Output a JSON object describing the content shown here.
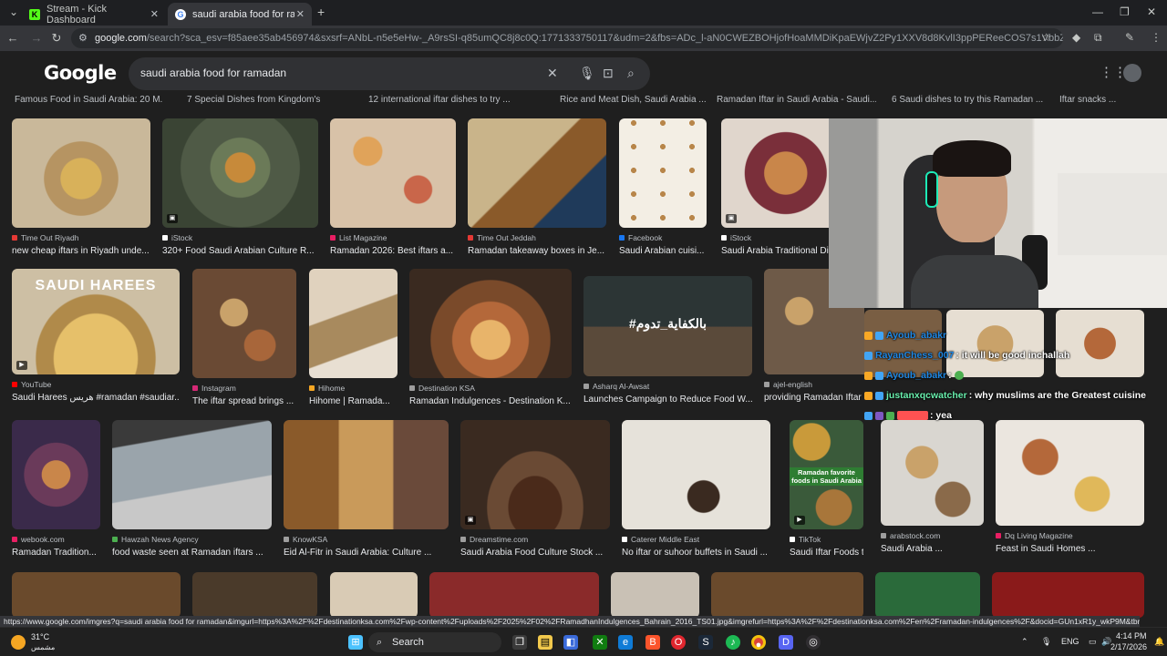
{
  "tabs": [
    {
      "title": "Stream - Kick Dashboard",
      "favicon": "K",
      "color": "#53fc18"
    },
    {
      "title": "saudi arabia food for ramadan",
      "favicon": "G",
      "color": "#ffffff"
    }
  ],
  "window": {
    "minimize": "—",
    "maximize": "❐",
    "close": "✕",
    "new_tab": "+"
  },
  "address": {
    "host": "google.com",
    "path": "/search?sca_esv=f85aee35ab456974&sxsrf=ANbL-n5e5eHw-_A9rsSI-q85umQC8j8c0Q:1771333750117&udm=2&fbs=ADc_l-aN0CWEZBOHjofHoaMMDiKpaEWjvZ2Py1XXV8d8KvlI3ppPEReeCOS7s1VbbZz2TLsHwpSX8VU1h5wlQRdyYz8mD..."
  },
  "google": {
    "logo": "Google",
    "query": "saudi arabia food for ramadan"
  },
  "top_row_captions": [
    "Famous Food in Saudi Arabia: 20 M...",
    "7 Special Dishes from Kingdom's ...",
    "12 international iftar dishes to try ...",
    "Rice and Meat Dish, Saudi Arabia ...",
    "Ramadan Iftar in Saudi Arabia - Saudi...",
    "6 Saudi dishes to try this Ramadan ...",
    "Iftar snacks ..."
  ],
  "rows": [
    [
      {
        "source": "Time Out Riyadh",
        "caption": "new cheap iftars in Riyadh unde...",
        "color": "#b69462",
        "src_color": "#e53935"
      },
      {
        "source": "iStock",
        "caption": "320+ Food Saudi Arabian Culture R...",
        "color": "#5c6b52",
        "src_color": "#ffffff"
      },
      {
        "source": "List Magazine",
        "caption": "Ramadan 2026: Best iftars a...",
        "color": "#c9a98a",
        "src_color": "#e91e63"
      },
      {
        "source": "Time Out Jeddah",
        "caption": "Ramadan takeaway boxes in Je...",
        "color": "#3a4c6a",
        "src_color": "#e53935"
      },
      {
        "source": "Facebook",
        "caption": "Saudi Arabian cuisi...",
        "color": "#f1ece2",
        "src_color": "#1877f2"
      },
      {
        "source": "iStock",
        "caption": "Saudi Arabia Traditional Dis...",
        "color": "#6a3744",
        "src_color": "#ffffff"
      }
    ],
    [
      {
        "source": "YouTube",
        "caption": "Saudi Harees هريس #ramadan #saudiar...",
        "color": "#cbb17c",
        "src_color": "#ff0000",
        "overlay": "SAUDI HAREES"
      },
      {
        "source": "Instagram",
        "caption": "The iftar spread brings ...",
        "color": "#8c5d3e",
        "src_color": "#d62976"
      },
      {
        "source": "Hihome",
        "caption": "Hihome | Ramada...",
        "color": "#bfa98e",
        "src_color": "#f5a623"
      },
      {
        "source": "Destination KSA",
        "caption": "Ramadan Indulgences - Destination K...",
        "color": "#a26a3c",
        "src_color": "#9e9e9e"
      },
      {
        "source": "Asharq Al-Awsat",
        "caption": "Launches Campaign to Reduce Food W...",
        "color": "#2f3a3a",
        "src_color": "#9e9e9e",
        "overlay": "#بالكفاية_تدوم"
      },
      {
        "source": "ajel-english",
        "caption": "providing Ramadan Iftar Meals ...",
        "color": "#8a6a4d",
        "src_color": "#9e9e9e"
      }
    ],
    [
      {
        "source": "webook.com",
        "caption": "Ramadan Tradition...",
        "color": "#7a4a6a",
        "src_color": "#e91e63"
      },
      {
        "source": "Hawzah News Agency",
        "caption": "food waste seen at Ramadan iftars ...",
        "color": "#7e8a93",
        "src_color": "#4caf50"
      },
      {
        "source": "KnowKSA",
        "caption": "Eid Al-Fitr in Saudi Arabia: Culture ...",
        "color": "#9a6a3a",
        "src_color": "#9e9e9e"
      },
      {
        "source": "Dreamstime.com",
        "caption": "Saudi Arabia Food Culture Stock ...",
        "color": "#4a3424",
        "src_color": "#9e9e9e"
      },
      {
        "source": "Caterer Middle East",
        "caption": "No iftar or suhoor buffets in Saudi ...",
        "color": "#d8d4cc",
        "src_color": "#ffffff"
      },
      {
        "source": "TikTok",
        "caption": "Saudi Iftar Foods t...",
        "color": "#b88a3a",
        "src_color": "#ffffff",
        "overlay": "Ramadan favorite foods in Saudi Arabia"
      },
      {
        "source": "arabstock.com",
        "caption": "Saudi Arabia ...",
        "color": "#d9d6d0",
        "src_color": "#9e9e9e"
      },
      {
        "source": "Dq Living Magazine",
        "caption": "Feast in Saudi Homes ...",
        "color": "#e6e1da",
        "src_color": "#e91e63"
      }
    ]
  ],
  "bottom_row_colors": [
    "#6a4a2c",
    "#4a3a2a",
    "#d9cbb5",
    "#8a2a2a",
    "#c9c1b5",
    "#6a4a2c",
    "#2a6a3a",
    "#8a1a1a"
  ],
  "chat": [
    {
      "user": "Ayoub_abakr",
      "message": "",
      "user_color": "#1e88e5",
      "badge": "#f9a825"
    },
    {
      "user": "RayanChess_007",
      "message": ": it will be good inchallah",
      "user_color": "#1e88e5",
      "badge": "#f9a825"
    },
    {
      "user": "Ayoub_abakr",
      "message": ":",
      "user_color": "#1e88e5",
      "badge": "#f9a825"
    },
    {
      "user": "justanxqcwatcher",
      "message": ": why muslims are the Greatest cuisine",
      "user_color": "#69f0ae",
      "badge": "#f9a825"
    },
    {
      "user": "",
      "message": ": yea",
      "user_color": "#ff5252",
      "badge": "#7e57c2"
    }
  ],
  "status_url": "https://www.google.com/imgres?q=saudi arabia food for ramadan&imgurl=https%3A%2F%2Fdestinationksa.com%2Fwp-content%2Fuploads%2F2025%2F02%2FRamadhanIndulgences_Bahrain_2016_TS01.jpg&imgrefurl=https%3A%2F%2Fdestinationksa.com%2Fen%2Framadan-indulgences%2F&docid=GUn1xR1y_wkP9M&tbnid=gaNau8HGv92kAM&v...",
  "taskbar": {
    "weather_temp": "31°C",
    "weather_desc": "مشمس",
    "search_label": "Search",
    "language": "ENG",
    "time": "4:14 PM",
    "date": "2/17/2026"
  }
}
